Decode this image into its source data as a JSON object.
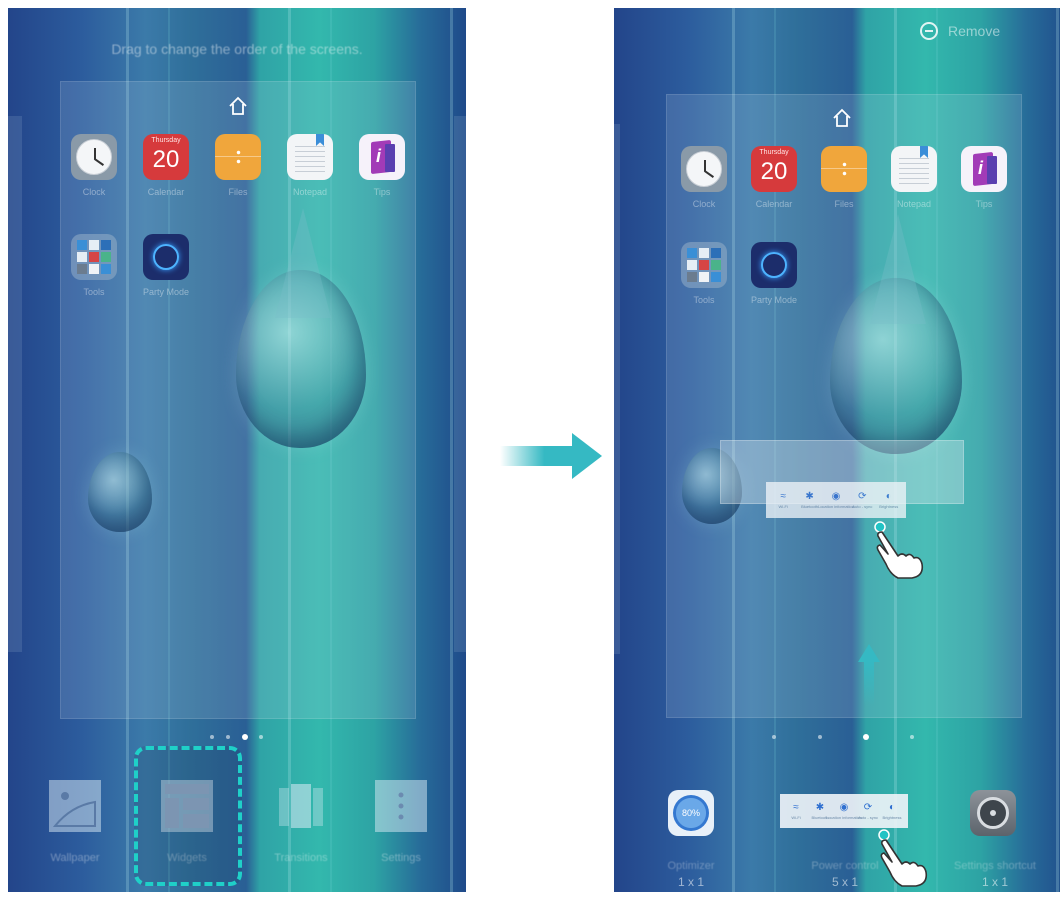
{
  "left_screen": {
    "hint": "Drag to change the order of the screens.",
    "apps_row1": [
      {
        "label": "Clock",
        "icon": "clock-icon"
      },
      {
        "label": "Calendar",
        "icon": "calendar-icon",
        "weekday": "Thursday",
        "day": "20"
      },
      {
        "label": "Files",
        "icon": "files-icon"
      },
      {
        "label": "Notepad",
        "icon": "notepad-icon"
      },
      {
        "label": "Tips",
        "icon": "tips-icon"
      }
    ],
    "apps_row2": [
      {
        "label": "Tools",
        "icon": "tools-folder-icon"
      },
      {
        "label": "Party Mode",
        "icon": "party-mode-icon"
      }
    ],
    "menu": [
      {
        "label": "Wallpaper",
        "icon": "wallpaper-icon"
      },
      {
        "label": "Widgets",
        "icon": "widgets-icon"
      },
      {
        "label": "Transitions",
        "icon": "transitions-icon"
      },
      {
        "label": "Settings",
        "icon": "settings-dots-icon"
      }
    ],
    "highlight_color": "#1fd0c8"
  },
  "right_screen": {
    "remove_label": "Remove",
    "apps_row1": [
      {
        "label": "Clock",
        "icon": "clock-icon"
      },
      {
        "label": "Calendar",
        "icon": "calendar-icon",
        "weekday": "Thursday",
        "day": "20"
      },
      {
        "label": "Files",
        "icon": "files-icon"
      },
      {
        "label": "Notepad",
        "icon": "notepad-icon"
      },
      {
        "label": "Tips",
        "icon": "tips-icon"
      }
    ],
    "apps_row2": [
      {
        "label": "Tools",
        "icon": "tools-folder-icon"
      },
      {
        "label": "Party Mode",
        "icon": "party-mode-icon"
      }
    ],
    "power_toggles": [
      {
        "label": "Wi-Fi",
        "icon": "wifi-icon"
      },
      {
        "label": "Bluetooth",
        "icon": "bluetooth-icon"
      },
      {
        "label": "Location information",
        "icon": "location-icon"
      },
      {
        "label": "Auto - sync",
        "icon": "sync-icon"
      },
      {
        "label": "Brightness",
        "icon": "brightness-icon"
      }
    ],
    "widgets": [
      {
        "name": "Optimizer",
        "size": "1 x 1",
        "value": "80%"
      },
      {
        "name": "Power control",
        "size": "5 x 1"
      },
      {
        "name": "Settings shortcut",
        "size": "1 x 1"
      }
    ]
  },
  "accent_color": "#35b9c3"
}
